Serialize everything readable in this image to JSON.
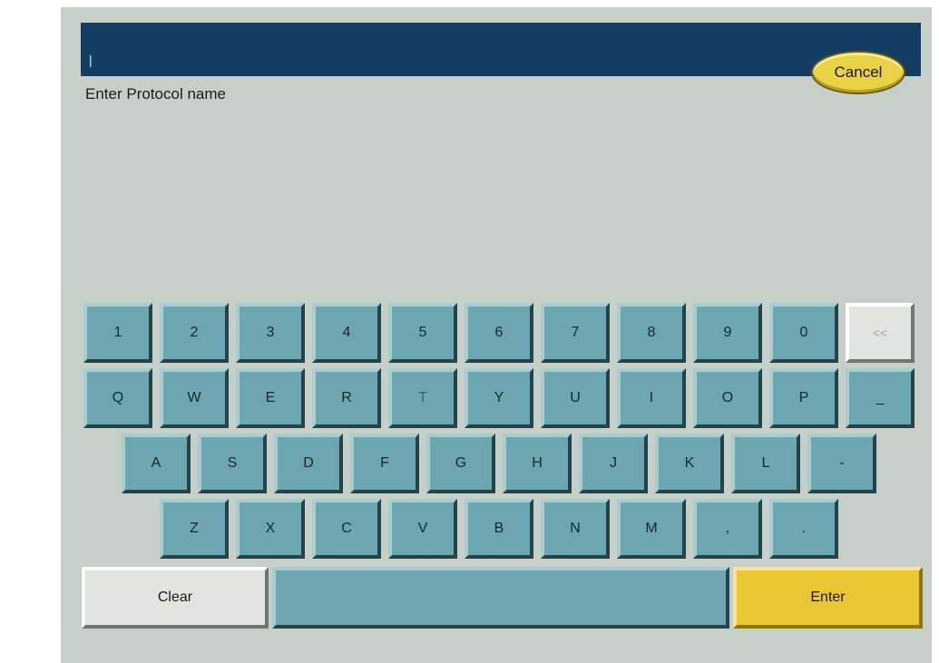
{
  "entry": {
    "value": "|"
  },
  "prompt": "Enter Protocol name",
  "cancel_label": "Cancel",
  "keys": {
    "row1": [
      "1",
      "2",
      "3",
      "4",
      "5",
      "6",
      "7",
      "8",
      "9",
      "0",
      "<<"
    ],
    "row2": [
      "Q",
      "W",
      "E",
      "R",
      "T",
      "Y",
      "U",
      "I",
      "O",
      "P",
      "_"
    ],
    "row3": [
      "A",
      "S",
      "D",
      "F",
      "G",
      "H",
      "J",
      "K",
      "L",
      "-"
    ],
    "row4": [
      "Z",
      "X",
      "C",
      "V",
      "B",
      "N",
      "M",
      ",",
      "."
    ],
    "clear_label": "Clear",
    "space_label": "",
    "enter_label": "Enter"
  },
  "colors": {
    "panel": "#c7d0c8",
    "entry_bar": "#133d63",
    "key": "#6ca6b0",
    "enter": "#ebc735",
    "cancel": "#ead247"
  }
}
